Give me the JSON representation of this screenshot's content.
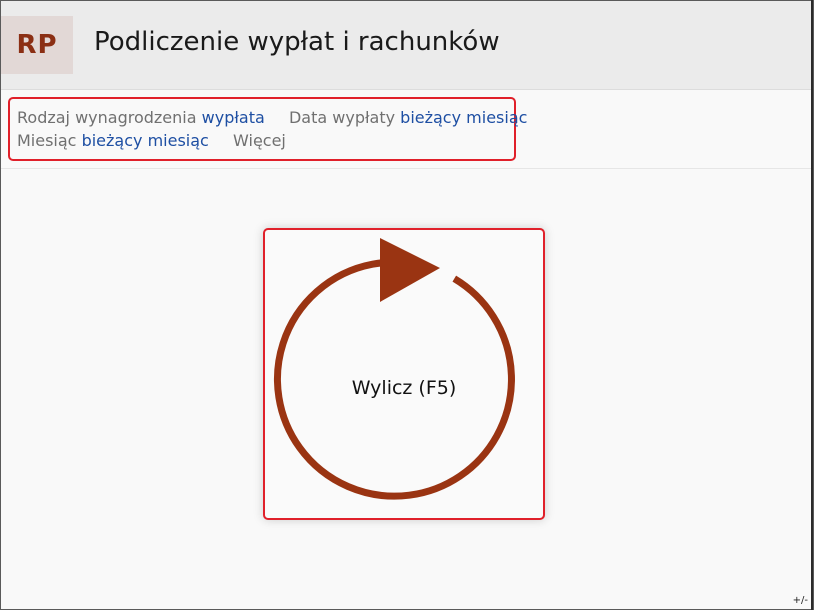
{
  "header": {
    "badge": "RP",
    "title": "Podliczenie wypłat i rachunków"
  },
  "filters": {
    "salary_type_label": "Rodzaj wynagrodzenia",
    "salary_type_value": "wypłata",
    "payment_date_label": "Data wypłaty",
    "payment_date_value": "bieżący miesiąc",
    "month_label": "Miesiąc",
    "month_value": "bieżący miesiąc",
    "more_label": "Więcej"
  },
  "action": {
    "calculate_label": "Wylicz (F5)",
    "icon": "refresh-circle-arrow-icon",
    "accent_color": "#9a3412"
  },
  "footer": {
    "corner_text": "+/-"
  },
  "colors": {
    "badge_text": "#8b2f14",
    "link": "#1e4fa3",
    "highlight_border": "#e0202a"
  }
}
